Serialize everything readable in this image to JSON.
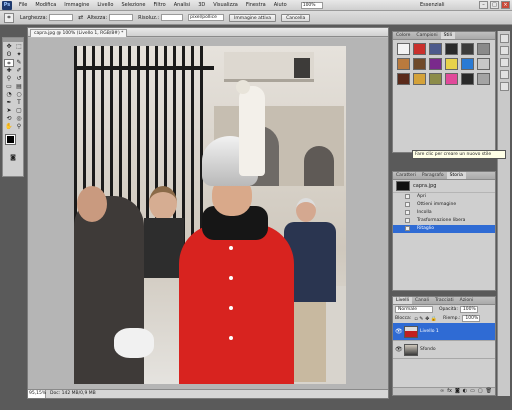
{
  "menubar": {
    "logo": "Ps",
    "items": [
      "File",
      "Modifica",
      "Immagine",
      "Livello",
      "Selezione",
      "Filtro",
      "Analisi",
      "3D",
      "Visualizza",
      "Finestra",
      "Aiuto"
    ],
    "zoom": "100%",
    "workspace": "Essenziali"
  },
  "options": {
    "width_label": "Larghezza:",
    "height_label": "Altezza:",
    "resolution_label": "Risoluz.:",
    "resolution_unit": "pixel/pollice",
    "front_image_button": "Immagine attiva",
    "clear_button": "Cancella"
  },
  "document": {
    "tab_title": "capra.jpg @ 100% (Livello 1, RGB/8#) *",
    "zoom": "95,15%",
    "doc_info": "Doc: 142 MB/0,9 MB"
  },
  "styles_panel": {
    "tabs": [
      "Colore",
      "Campioni",
      "Stili"
    ],
    "active_tab": 2,
    "swatch_colors": [
      "#f2f2f2",
      "#c9302c",
      "#4d5a8c",
      "#2a2a2a",
      "#3c3c3c",
      "#8a8a8a",
      "#b97a3d",
      "#6f4a2a",
      "#7a2a8c",
      "#e8d24a",
      "#2a7ad4",
      "#c8c8c8",
      "#5a2a1a",
      "#d4a23a",
      "#8c8c4a",
      "#e04a9a",
      "#2a2a2a",
      "#a4a4a4"
    ]
  },
  "tooltip": "Fare clic per creare un nuovo stile",
  "history_panel": {
    "tabs": [
      "Caratteri",
      "Paragrafo",
      "Storia"
    ],
    "active_tab": 2,
    "snapshot": "capra.jpg",
    "steps": [
      "Apri",
      "Ottieni immagine",
      "Incolla",
      "Trasformazione libera",
      "Ritaglio"
    ],
    "selected_step": 4
  },
  "layers_panel": {
    "tabs": [
      "Livelli",
      "Canali",
      "Tracciati",
      "Azioni"
    ],
    "active_tab": 0,
    "blend_mode": "Normale",
    "opacity_label": "Opacità:",
    "opacity": "100%",
    "lock_label": "Blocca:",
    "fill_label": "Riemp.:",
    "fill": "100%",
    "layers": [
      {
        "name": "Livello 1",
        "selected": true
      },
      {
        "name": "Sfondo",
        "selected": false
      }
    ]
  },
  "colors": {
    "selection_blue": "#2f6bd4",
    "panel_bg": "#cfcfcf",
    "canvas_bg": "#b5b5b5"
  }
}
